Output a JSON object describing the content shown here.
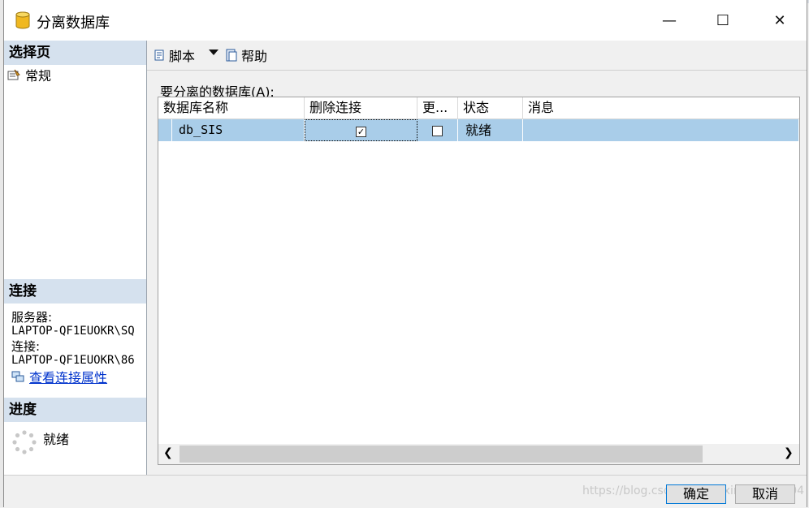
{
  "window": {
    "title": "分离数据库",
    "minimize_glyph": "—",
    "maximize_glyph": "☐",
    "close_glyph": "✕"
  },
  "left_pane": {
    "pages_header": "选择页",
    "pages": [
      {
        "label": "常规",
        "icon": "properties-icon"
      }
    ],
    "connection_header": "连接",
    "server_label": "服务器:",
    "server_value": "LAPTOP-QF1EUOKR\\SQ",
    "connection_label": "连接:",
    "connection_value": "LAPTOP-QF1EUOKR\\86",
    "view_props_link": "查看连接属性",
    "progress_header": "进度",
    "progress_status": "就绪"
  },
  "toolbar": {
    "script_label": "脚本",
    "help_label": "帮助"
  },
  "grid": {
    "caption": "要分离的数据库(A):",
    "columns": [
      "数据库名称",
      "删除连接",
      "更...",
      "状态",
      "消息"
    ],
    "rows": [
      {
        "name": "db_SIS",
        "drop_connections": true,
        "update_statistics": false,
        "status": "就绪",
        "message": ""
      }
    ],
    "check_glyph": "✓"
  },
  "buttons": {
    "ok": "确定",
    "cancel": "取消"
  },
  "watermark": "https://blog.csdn.net/weixin_45432404",
  "colors": {
    "selected_row": "#a9cde9",
    "section_header": "#d5e1ee",
    "link": "#0033cc"
  }
}
